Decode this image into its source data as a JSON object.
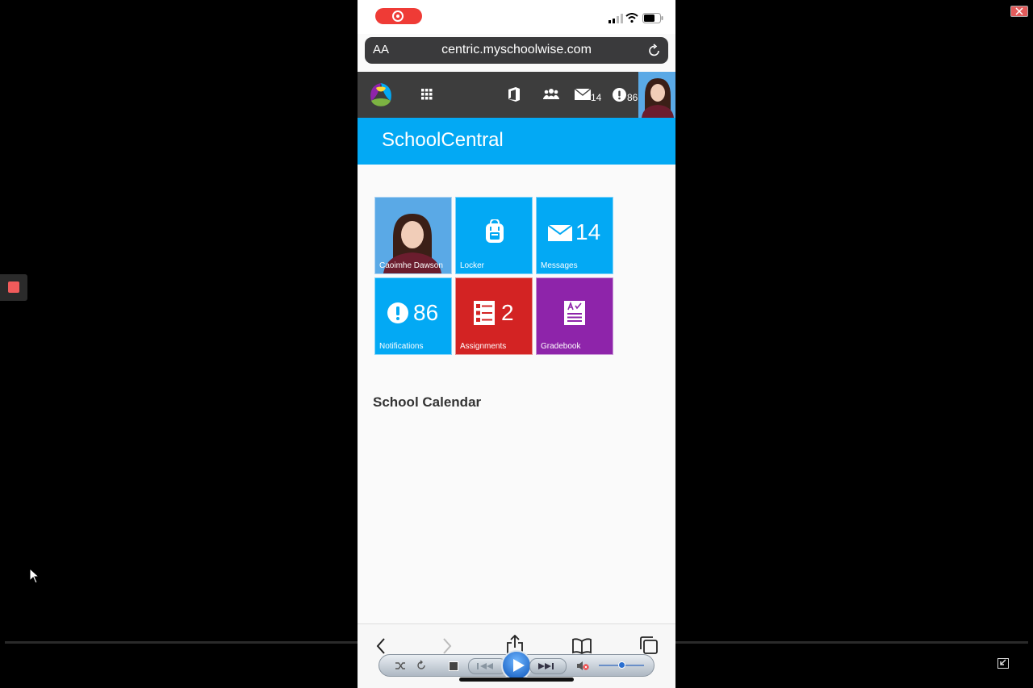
{
  "browser": {
    "text_size_label": "AA",
    "url": "centric.myschoolwise.com"
  },
  "header": {
    "messages_count": "14",
    "notifications_count": "86"
  },
  "app": {
    "title": "SchoolCentral"
  },
  "tiles": [
    {
      "label": "Caoimhe Dawson",
      "color": "#5aa9e6"
    },
    {
      "label": "Locker",
      "color": "#03a9f4"
    },
    {
      "label": "Messages",
      "count": "14",
      "color": "#03a9f4"
    },
    {
      "label": "Notifications",
      "count": "86",
      "color": "#03a9f4"
    },
    {
      "label": "Assignments",
      "count": "2",
      "color": "#d32323"
    },
    {
      "label": "Gradebook",
      "color": "#8e24aa"
    }
  ],
  "calendar": {
    "heading": "School Calendar"
  },
  "colors": {
    "header_bg": "#3d3d3d",
    "banner_bg": "#03a9f4",
    "record_pill": "#ef3b36"
  }
}
